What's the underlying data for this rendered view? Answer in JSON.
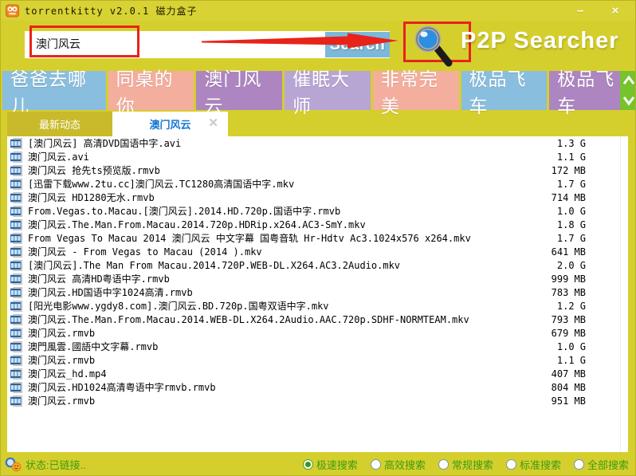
{
  "window": {
    "title": "torrentkitty v2.0.1 磁力盒子",
    "minimize_glyph": "–",
    "close_glyph": "×"
  },
  "icons": {
    "app_icon": "torrentkitty-logo",
    "magnifier": "magnifying-glass",
    "tab_close": "✕",
    "scroll_up": "chevron-up",
    "scroll_down": "chevron-down",
    "film": "film-strip",
    "status": "magnifier-smiley"
  },
  "search": {
    "query": "澳门风云",
    "button_label": "Search",
    "brand": "P2P Searcher"
  },
  "categories": [
    {
      "label": "爸爸去哪儿",
      "color": "#8abede"
    },
    {
      "label": "同桌的你",
      "color": "#f4ae9d"
    },
    {
      "label": "澳门风云",
      "color": "#ad85c0"
    },
    {
      "label": "催眠大师",
      "color": "#b7a5d3"
    },
    {
      "label": "非常完美",
      "color": "#f4ae9d"
    },
    {
      "label": "极品飞车",
      "color": "#8abede"
    },
    {
      "label": "极品飞车",
      "color": "#ad85c0"
    }
  ],
  "tabs": [
    {
      "label": "最新动态",
      "active": false
    },
    {
      "label": "澳门风云",
      "active": true,
      "closable": true
    }
  ],
  "results": [
    {
      "name": "[澳门风云] 高清DVD国语中字.avi",
      "size": "1.3 G"
    },
    {
      "name": "澳门风云.avi",
      "size": "1.1 G"
    },
    {
      "name": "澳门风云 抢先ts预览版.rmvb",
      "size": "172 MB"
    },
    {
      "name": "[迅雷下载www.2tu.cc]澳门风云.TC1280高清国语中字.mkv",
      "size": "1.7 G"
    },
    {
      "name": "澳门风云 HD1280无水.rmvb",
      "size": "714 MB"
    },
    {
      "name": "From.Vegas.to.Macau.[澳门风云].2014.HD.720p.国语中字.rmvb",
      "size": "1.0 G"
    },
    {
      "name": "澳门风云.The.Man.From.Macau.2014.720p.HDRip.x264.AC3-SmY.mkv",
      "size": "1.8 G"
    },
    {
      "name": "From Vegas To Macau 2014 澳门风云 中文字幕 国粤音轨 Hr-Hdtv Ac3.1024x576 x264.mkv",
      "size": "1.7 G"
    },
    {
      "name": "澳门风云 - From Vegas to Macau (2014 ).mkv",
      "size": "641 MB"
    },
    {
      "name": "[澳门风云].The Man From Macau.2014.720P.WEB-DL.X264.AC3.2Audio.mkv",
      "size": "2.0 G"
    },
    {
      "name": "澳门风云 高清HD粤语中字.rmvb",
      "size": "999 MB"
    },
    {
      "name": "澳门风云.HD国语中字1024高清.rmvb",
      "size": "783 MB"
    },
    {
      "name": "[阳光电影www.ygdy8.com].澳门风云.BD.720p.国粤双语中字.mkv",
      "size": "1.2 G"
    },
    {
      "name": "澳门风云.The.Man.From.Macau.2014.WEB-DL.X264.2Audio.AAC.720p.SDHF-NORMTEAM.mkv",
      "size": "793 MB"
    },
    {
      "name": "澳门风云.rmvb",
      "size": "679 MB"
    },
    {
      "name": "澳門風雲.國語中文字幕.rmvb",
      "size": "1.0 G"
    },
    {
      "name": "澳门风云.rmvb",
      "size": "1.1 G"
    },
    {
      "name": "澳门风云_hd.mp4",
      "size": "407 MB"
    },
    {
      "name": "澳门风云.HD1024高清粤语中字rmvb.rmvb",
      "size": "804 MB"
    },
    {
      "name": "澳门风云.rmvb",
      "size": "951 MB"
    }
  ],
  "status": {
    "text": "状态:已链接..",
    "modes": [
      {
        "label": "极速搜索",
        "selected": true
      },
      {
        "label": "高效搜索",
        "selected": false
      },
      {
        "label": "常规搜索",
        "selected": false
      },
      {
        "label": "标准搜索",
        "selected": false
      },
      {
        "label": "全部搜索",
        "selected": false
      }
    ]
  },
  "colors": {
    "window_bg": "#d5cf2d",
    "titlebar_bg": "#d8d234",
    "annotation_red": "#e8231a",
    "search_button_bg": "#7cb8da",
    "tab_inactive_bg": "#c8ba2a",
    "tab_active_text": "#1676d2",
    "status_green": "#3e9c10",
    "scroll_strip_green": "#76c32d"
  }
}
